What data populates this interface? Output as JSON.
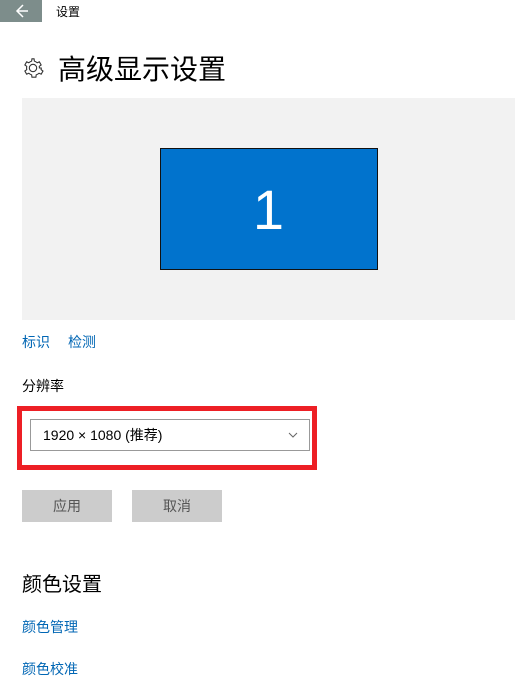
{
  "header": {
    "title": "设置"
  },
  "page": {
    "title": "高级显示设置"
  },
  "display": {
    "monitor_number": "1"
  },
  "links": {
    "identify": "标识",
    "detect": "检测"
  },
  "resolution": {
    "label": "分辨率",
    "value": "1920 × 1080 (推荐)"
  },
  "buttons": {
    "apply": "应用",
    "cancel": "取消"
  },
  "color_section": {
    "title": "颜色设置",
    "management": "颜色管理",
    "calibration": "颜色校准"
  }
}
